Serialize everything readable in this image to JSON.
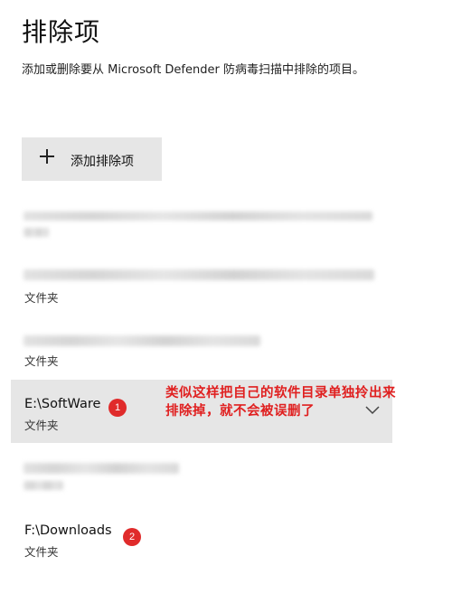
{
  "page": {
    "title": "排除项",
    "description": "添加或删除要从 Microsoft Defender 防病毒扫描中排除的项目。"
  },
  "add_button": {
    "label": "添加排除项",
    "icon": "plus-icon"
  },
  "exclusions": [
    {
      "path": "",
      "type": "",
      "blurred": true
    },
    {
      "path": "",
      "type": "文件夹",
      "blurred": true
    },
    {
      "path": "",
      "type": "文件夹",
      "blurred": true
    },
    {
      "path": "E:\\SoftWare",
      "type": "文件夹",
      "selected": true,
      "badge": "1"
    },
    {
      "path": "",
      "type": "",
      "blurred": true
    },
    {
      "path": "F:\\Downloads",
      "type": "文件夹",
      "badge": "2"
    }
  ],
  "annotation": {
    "line1": "类似这样把自己的软件目录单独拎出来",
    "line2": "排除掉，就不会被误删了",
    "color": "#e02020"
  },
  "colors": {
    "selected_bg": "#e6e6e6",
    "badge": "#e02b2b"
  }
}
